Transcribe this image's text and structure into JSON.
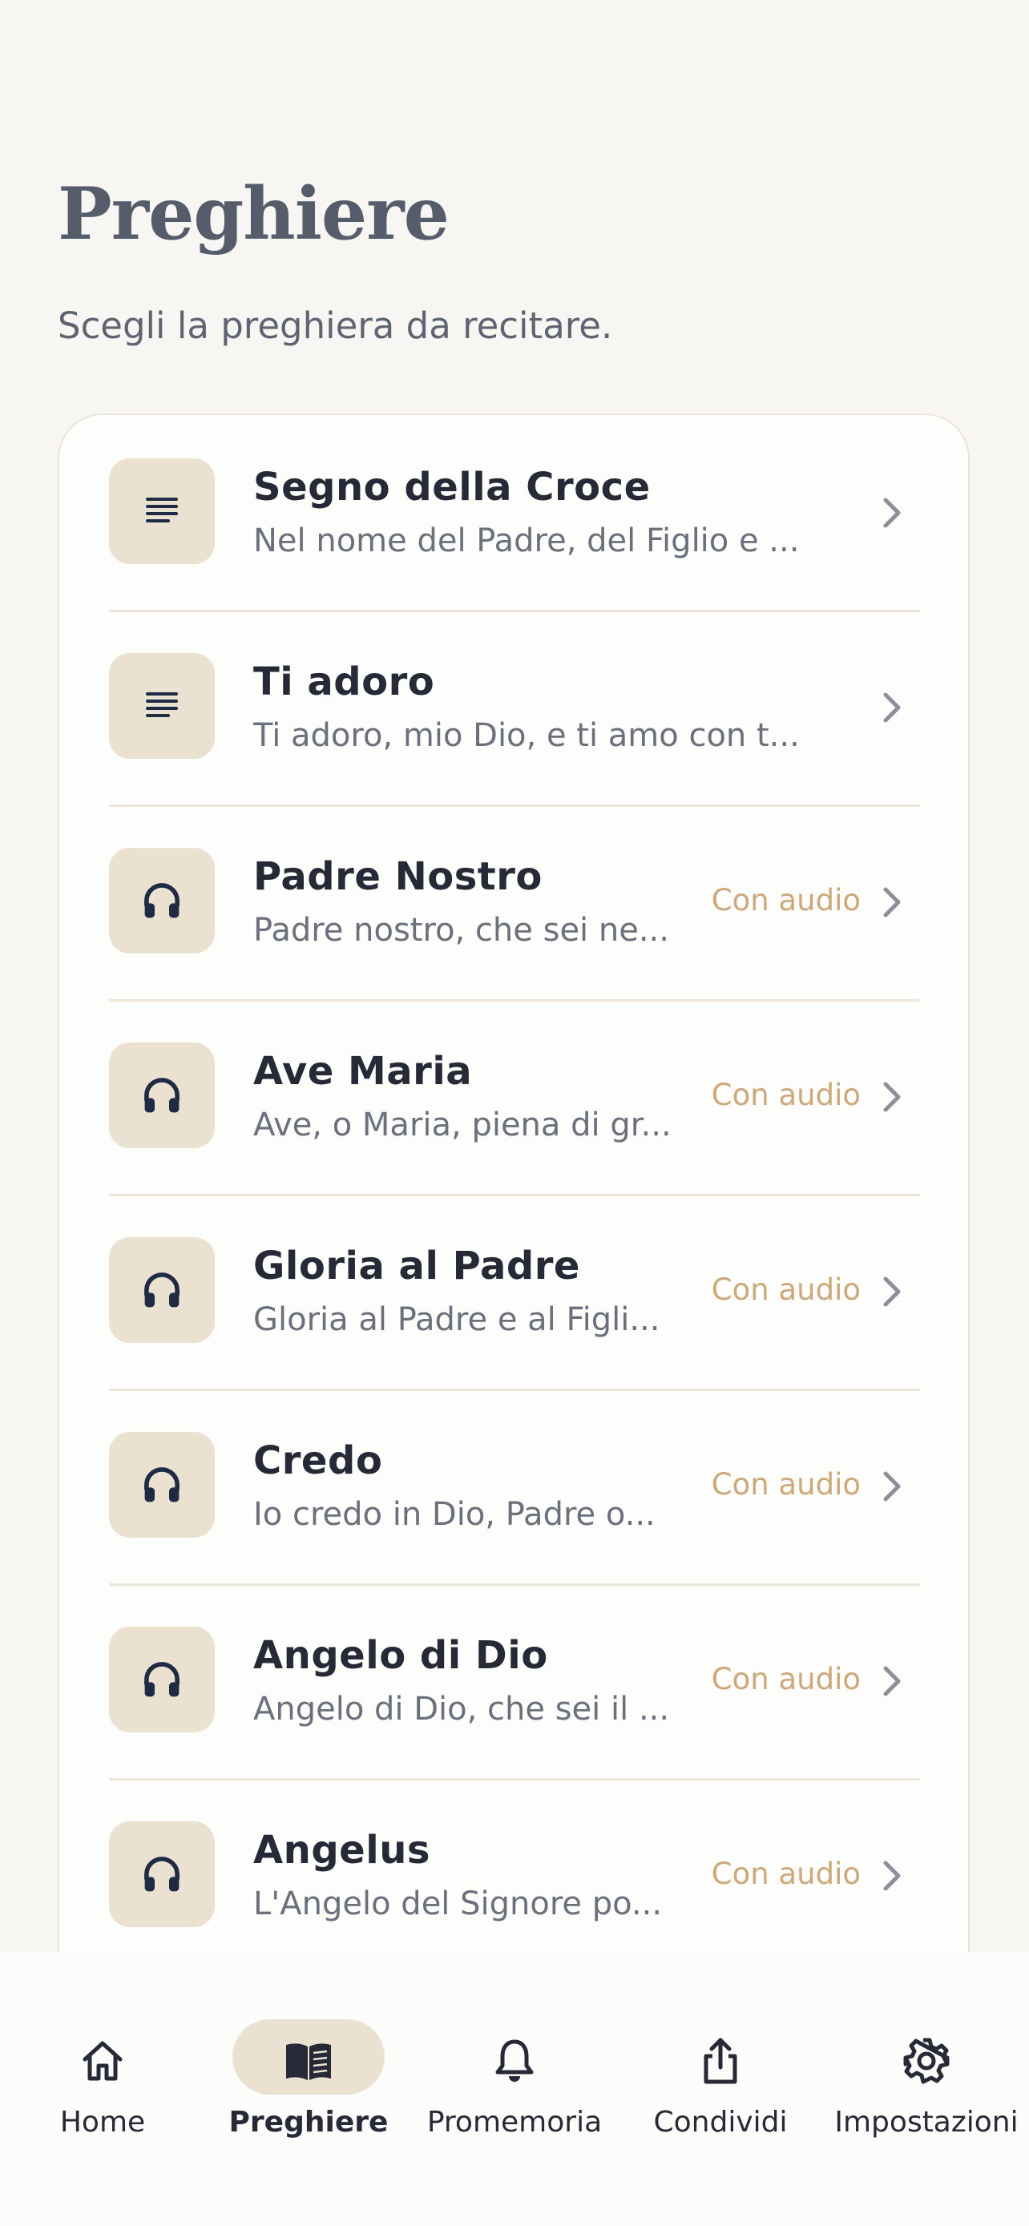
{
  "header": {
    "title": "Preghiere",
    "subtitle": "Scegli la preghiera da recitare."
  },
  "colors": {
    "background": "#f7f6f3",
    "icon_tile": "#ebe1d1",
    "accent_gold": "#cda979",
    "text_dark": "#262a36",
    "text_muted": "#6a707c"
  },
  "prayers": [
    {
      "title": "Segno della Croce",
      "preview": "Nel nome del Padre, del Figlio e ...",
      "badge": "",
      "icon": "text-lines-icon"
    },
    {
      "title": "Ti adoro",
      "preview": "Ti adoro, mio Dio, e ti amo con t...",
      "badge": "",
      "icon": "text-lines-icon"
    },
    {
      "title": "Padre Nostro",
      "preview": "Padre nostro, che sei ne...",
      "badge": "Con audio",
      "icon": "headphones-icon"
    },
    {
      "title": "Ave Maria",
      "preview": "Ave, o Maria, piena di gr...",
      "badge": "Con audio",
      "icon": "headphones-icon"
    },
    {
      "title": "Gloria al Padre",
      "preview": "Gloria al Padre e al Figli...",
      "badge": "Con audio",
      "icon": "headphones-icon"
    },
    {
      "title": "Credo",
      "preview": "Io credo in Dio, Padre o...",
      "badge": "Con audio",
      "icon": "headphones-icon"
    },
    {
      "title": "Angelo di Dio",
      "preview": "Angelo di Dio, che sei il ...",
      "badge": "Con audio",
      "icon": "headphones-icon"
    },
    {
      "title": "Angelus",
      "preview": "L'Angelo del Signore po...",
      "badge": "Con audio",
      "icon": "headphones-icon"
    }
  ],
  "tabbar": {
    "active": "Preghiere",
    "tabs": [
      {
        "label": "Home",
        "icon": "home-icon"
      },
      {
        "label": "Preghiere",
        "icon": "book-icon"
      },
      {
        "label": "Promemoria",
        "icon": "bell-icon"
      },
      {
        "label": "Condividi",
        "icon": "share-icon"
      },
      {
        "label": "Impostazioni",
        "icon": "gear-icon"
      }
    ]
  }
}
